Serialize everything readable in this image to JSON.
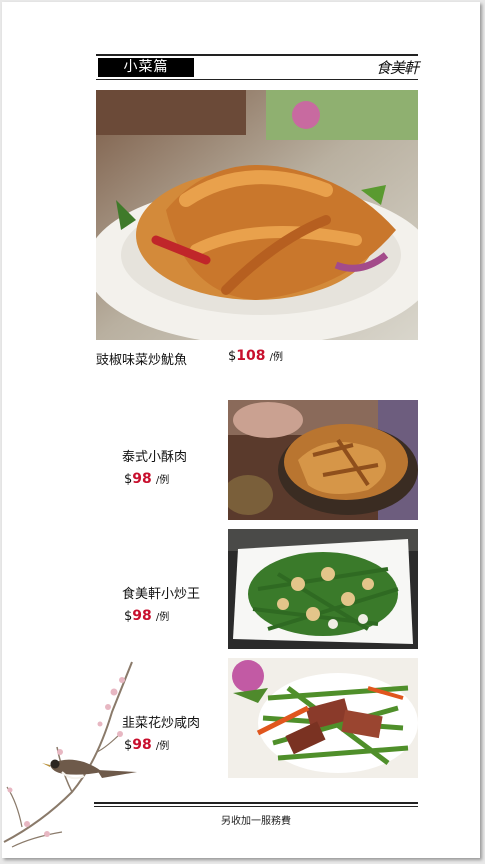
{
  "header": {
    "section_title": "小菜篇",
    "brand_logo_text": "食美軒"
  },
  "featured_dish": {
    "name": "豉椒味菜炒魷魚",
    "currency": "$",
    "price": "108",
    "unit": "/例",
    "photo_icon": "stir-fried-squid-photo"
  },
  "dishes": [
    {
      "name": "泰式小酥肉",
      "currency": "$",
      "price": "98",
      "unit": "/例",
      "photo_icon": "crispy-pork-photo"
    },
    {
      "name": "食美軒小炒王",
      "currency": "$",
      "price": "98",
      "unit": "/例",
      "photo_icon": "green-bean-cashew-stirfry-photo"
    },
    {
      "name": "韭菜花炒咸肉",
      "currency": "$",
      "price": "98",
      "unit": "/例",
      "photo_icon": "chive-flower-bacon-photo"
    }
  ],
  "footer": {
    "note": "另收加一服務費"
  },
  "colors": {
    "price_accent": "#c8102e",
    "title_bg": "#000000"
  }
}
